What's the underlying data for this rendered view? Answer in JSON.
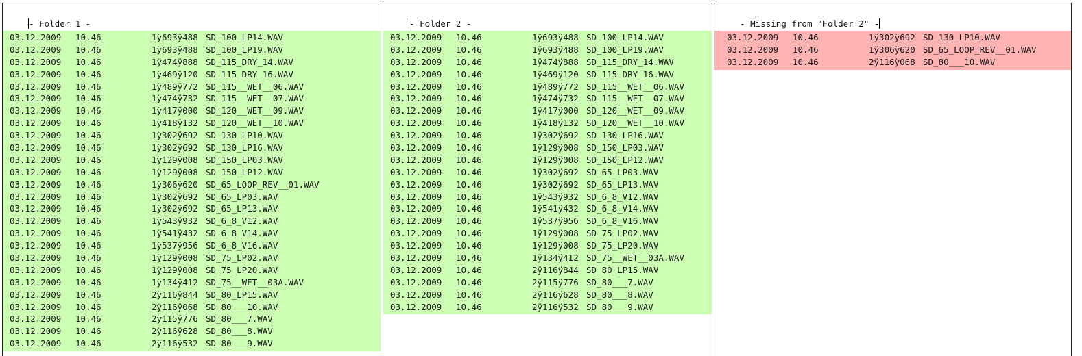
{
  "panels": [
    {
      "header_prefix": "- Folder 1 -",
      "rows": [
        {
          "date": "03.12.2009",
          "time": "10.46",
          "size": "1ÿ693ÿ488",
          "name": "SD_100_LP14.WAV"
        },
        {
          "date": "03.12.2009",
          "time": "10.46",
          "size": "1ÿ693ÿ488",
          "name": "SD_100_LP19.WAV"
        },
        {
          "date": "03.12.2009",
          "time": "10.46",
          "size": "1ÿ474ÿ888",
          "name": "SD_115_DRY_14.WAV"
        },
        {
          "date": "03.12.2009",
          "time": "10.46",
          "size": "1ÿ469ÿ120",
          "name": "SD_115_DRY_16.WAV"
        },
        {
          "date": "03.12.2009",
          "time": "10.46",
          "size": "1ÿ489ÿ772",
          "name": "SD_115__WET__06.WAV"
        },
        {
          "date": "03.12.2009",
          "time": "10.46",
          "size": "1ÿ474ÿ732",
          "name": "SD_115__WET__07.WAV"
        },
        {
          "date": "03.12.2009",
          "time": "10.46",
          "size": "1ÿ417ÿ000",
          "name": "SD_120__WET__09.WAV"
        },
        {
          "date": "03.12.2009",
          "time": "10.46",
          "size": "1ÿ418ÿ132",
          "name": "SD_120__WET__10.WAV"
        },
        {
          "date": "03.12.2009",
          "time": "10.46",
          "size": "1ÿ302ÿ692",
          "name": "SD_130_LP10.WAV"
        },
        {
          "date": "03.12.2009",
          "time": "10.46",
          "size": "1ÿ302ÿ692",
          "name": "SD_130_LP16.WAV"
        },
        {
          "date": "03.12.2009",
          "time": "10.46",
          "size": "1ÿ129ÿ008",
          "name": "SD_150_LP03.WAV"
        },
        {
          "date": "03.12.2009",
          "time": "10.46",
          "size": "1ÿ129ÿ008",
          "name": "SD_150_LP12.WAV"
        },
        {
          "date": "03.12.2009",
          "time": "10.46",
          "size": "1ÿ306ÿ620",
          "name": "SD_65_LOOP_REV__01.WAV"
        },
        {
          "date": "03.12.2009",
          "time": "10.46",
          "size": "1ÿ302ÿ692",
          "name": "SD_65_LP03.WAV"
        },
        {
          "date": "03.12.2009",
          "time": "10.46",
          "size": "1ÿ302ÿ692",
          "name": "SD_65_LP13.WAV"
        },
        {
          "date": "03.12.2009",
          "time": "10.46",
          "size": "1ÿ543ÿ932",
          "name": "SD_6_8_V12.WAV"
        },
        {
          "date": "03.12.2009",
          "time": "10.46",
          "size": "1ÿ541ÿ432",
          "name": "SD_6_8_V14.WAV"
        },
        {
          "date": "03.12.2009",
          "time": "10.46",
          "size": "1ÿ537ÿ956",
          "name": "SD_6_8_V16.WAV"
        },
        {
          "date": "03.12.2009",
          "time": "10.46",
          "size": "1ÿ129ÿ008",
          "name": "SD_75_LP02.WAV"
        },
        {
          "date": "03.12.2009",
          "time": "10.46",
          "size": "1ÿ129ÿ008",
          "name": "SD_75_LP20.WAV"
        },
        {
          "date": "03.12.2009",
          "time": "10.46",
          "size": "1ÿ134ÿ412",
          "name": "SD_75__WET__03A.WAV"
        },
        {
          "date": "03.12.2009",
          "time": "10.46",
          "size": "2ÿ116ÿ844",
          "name": "SD_80_LP15.WAV"
        },
        {
          "date": "03.12.2009",
          "time": "10.46",
          "size": "2ÿ116ÿ068",
          "name": "SD_80___10.WAV"
        },
        {
          "date": "03.12.2009",
          "time": "10.46",
          "size": "2ÿ115ÿ776",
          "name": "SD_80___7.WAV"
        },
        {
          "date": "03.12.2009",
          "time": "10.46",
          "size": "2ÿ116ÿ628",
          "name": "SD_80___8.WAV"
        },
        {
          "date": "03.12.2009",
          "time": "10.46",
          "size": "2ÿ116ÿ532",
          "name": "SD_80___9.WAV"
        }
      ]
    },
    {
      "header_prefix": "- Folder 2 -",
      "rows": [
        {
          "date": "03.12.2009",
          "time": "10.46",
          "size": "1ÿ693ÿ488",
          "name": "SD_100_LP14.WAV"
        },
        {
          "date": "03.12.2009",
          "time": "10.46",
          "size": "1ÿ693ÿ488",
          "name": "SD_100_LP19.WAV"
        },
        {
          "date": "03.12.2009",
          "time": "10.46",
          "size": "1ÿ474ÿ888",
          "name": "SD_115_DRY_14.WAV"
        },
        {
          "date": "03.12.2009",
          "time": "10.46",
          "size": "1ÿ469ÿ120",
          "name": "SD_115_DRY_16.WAV"
        },
        {
          "date": "03.12.2009",
          "time": "10.46",
          "size": "1ÿ489ÿ772",
          "name": "SD_115__WET__06.WAV"
        },
        {
          "date": "03.12.2009",
          "time": "10.46",
          "size": "1ÿ474ÿ732",
          "name": "SD_115__WET__07.WAV"
        },
        {
          "date": "03.12.2009",
          "time": "10.46",
          "size": "1ÿ417ÿ000",
          "name": "SD_120__WET__09.WAV"
        },
        {
          "date": "03.12.2009",
          "time": "10.46",
          "size": "1ÿ418ÿ132",
          "name": "SD_120__WET__10.WAV"
        },
        {
          "date": "03.12.2009",
          "time": "10.46",
          "size": "1ÿ302ÿ692",
          "name": "SD_130_LP16.WAV"
        },
        {
          "date": "03.12.2009",
          "time": "10.46",
          "size": "1ÿ129ÿ008",
          "name": "SD_150_LP03.WAV"
        },
        {
          "date": "03.12.2009",
          "time": "10.46",
          "size": "1ÿ129ÿ008",
          "name": "SD_150_LP12.WAV"
        },
        {
          "date": "03.12.2009",
          "time": "10.46",
          "size": "1ÿ302ÿ692",
          "name": "SD_65_LP03.WAV"
        },
        {
          "date": "03.12.2009",
          "time": "10.46",
          "size": "1ÿ302ÿ692",
          "name": "SD_65_LP13.WAV"
        },
        {
          "date": "03.12.2009",
          "time": "10.46",
          "size": "1ÿ543ÿ932",
          "name": "SD_6_8_V12.WAV"
        },
        {
          "date": "03.12.2009",
          "time": "10.46",
          "size": "1ÿ541ÿ432",
          "name": "SD_6_8_V14.WAV"
        },
        {
          "date": "03.12.2009",
          "time": "10.46",
          "size": "1ÿ537ÿ956",
          "name": "SD_6_8_V16.WAV"
        },
        {
          "date": "03.12.2009",
          "time": "10.46",
          "size": "1ÿ129ÿ008",
          "name": "SD_75_LP02.WAV"
        },
        {
          "date": "03.12.2009",
          "time": "10.46",
          "size": "1ÿ129ÿ008",
          "name": "SD_75_LP20.WAV"
        },
        {
          "date": "03.12.2009",
          "time": "10.46",
          "size": "1ÿ134ÿ412",
          "name": "SD_75__WET__03A.WAV"
        },
        {
          "date": "03.12.2009",
          "time": "10.46",
          "size": "2ÿ116ÿ844",
          "name": "SD_80_LP15.WAV"
        },
        {
          "date": "03.12.2009",
          "time": "10.46",
          "size": "2ÿ115ÿ776",
          "name": "SD_80___7.WAV"
        },
        {
          "date": "03.12.2009",
          "time": "10.46",
          "size": "2ÿ116ÿ628",
          "name": "SD_80___8.WAV"
        },
        {
          "date": "03.12.2009",
          "time": "10.46",
          "size": "2ÿ116ÿ532",
          "name": "SD_80___9.WAV"
        }
      ]
    },
    {
      "header_prefix": "- Missing from \"Folder 2\" -",
      "rows": [
        {
          "date": "03.12.2009",
          "time": "10.46",
          "size": "1ÿ302ÿ692",
          "name": "SD_130_LP10.WAV"
        },
        {
          "date": "03.12.2009",
          "time": "10.46",
          "size": "1ÿ306ÿ620",
          "name": "SD_65_LOOP_REV__01.WAV"
        },
        {
          "date": "03.12.2009",
          "time": "10.46",
          "size": "2ÿ116ÿ068",
          "name": "SD_80___10.WAV"
        }
      ]
    }
  ],
  "colors": {
    "present_row_bg": "#ccffb3",
    "missing_row_bg": "#ffb3b3"
  }
}
